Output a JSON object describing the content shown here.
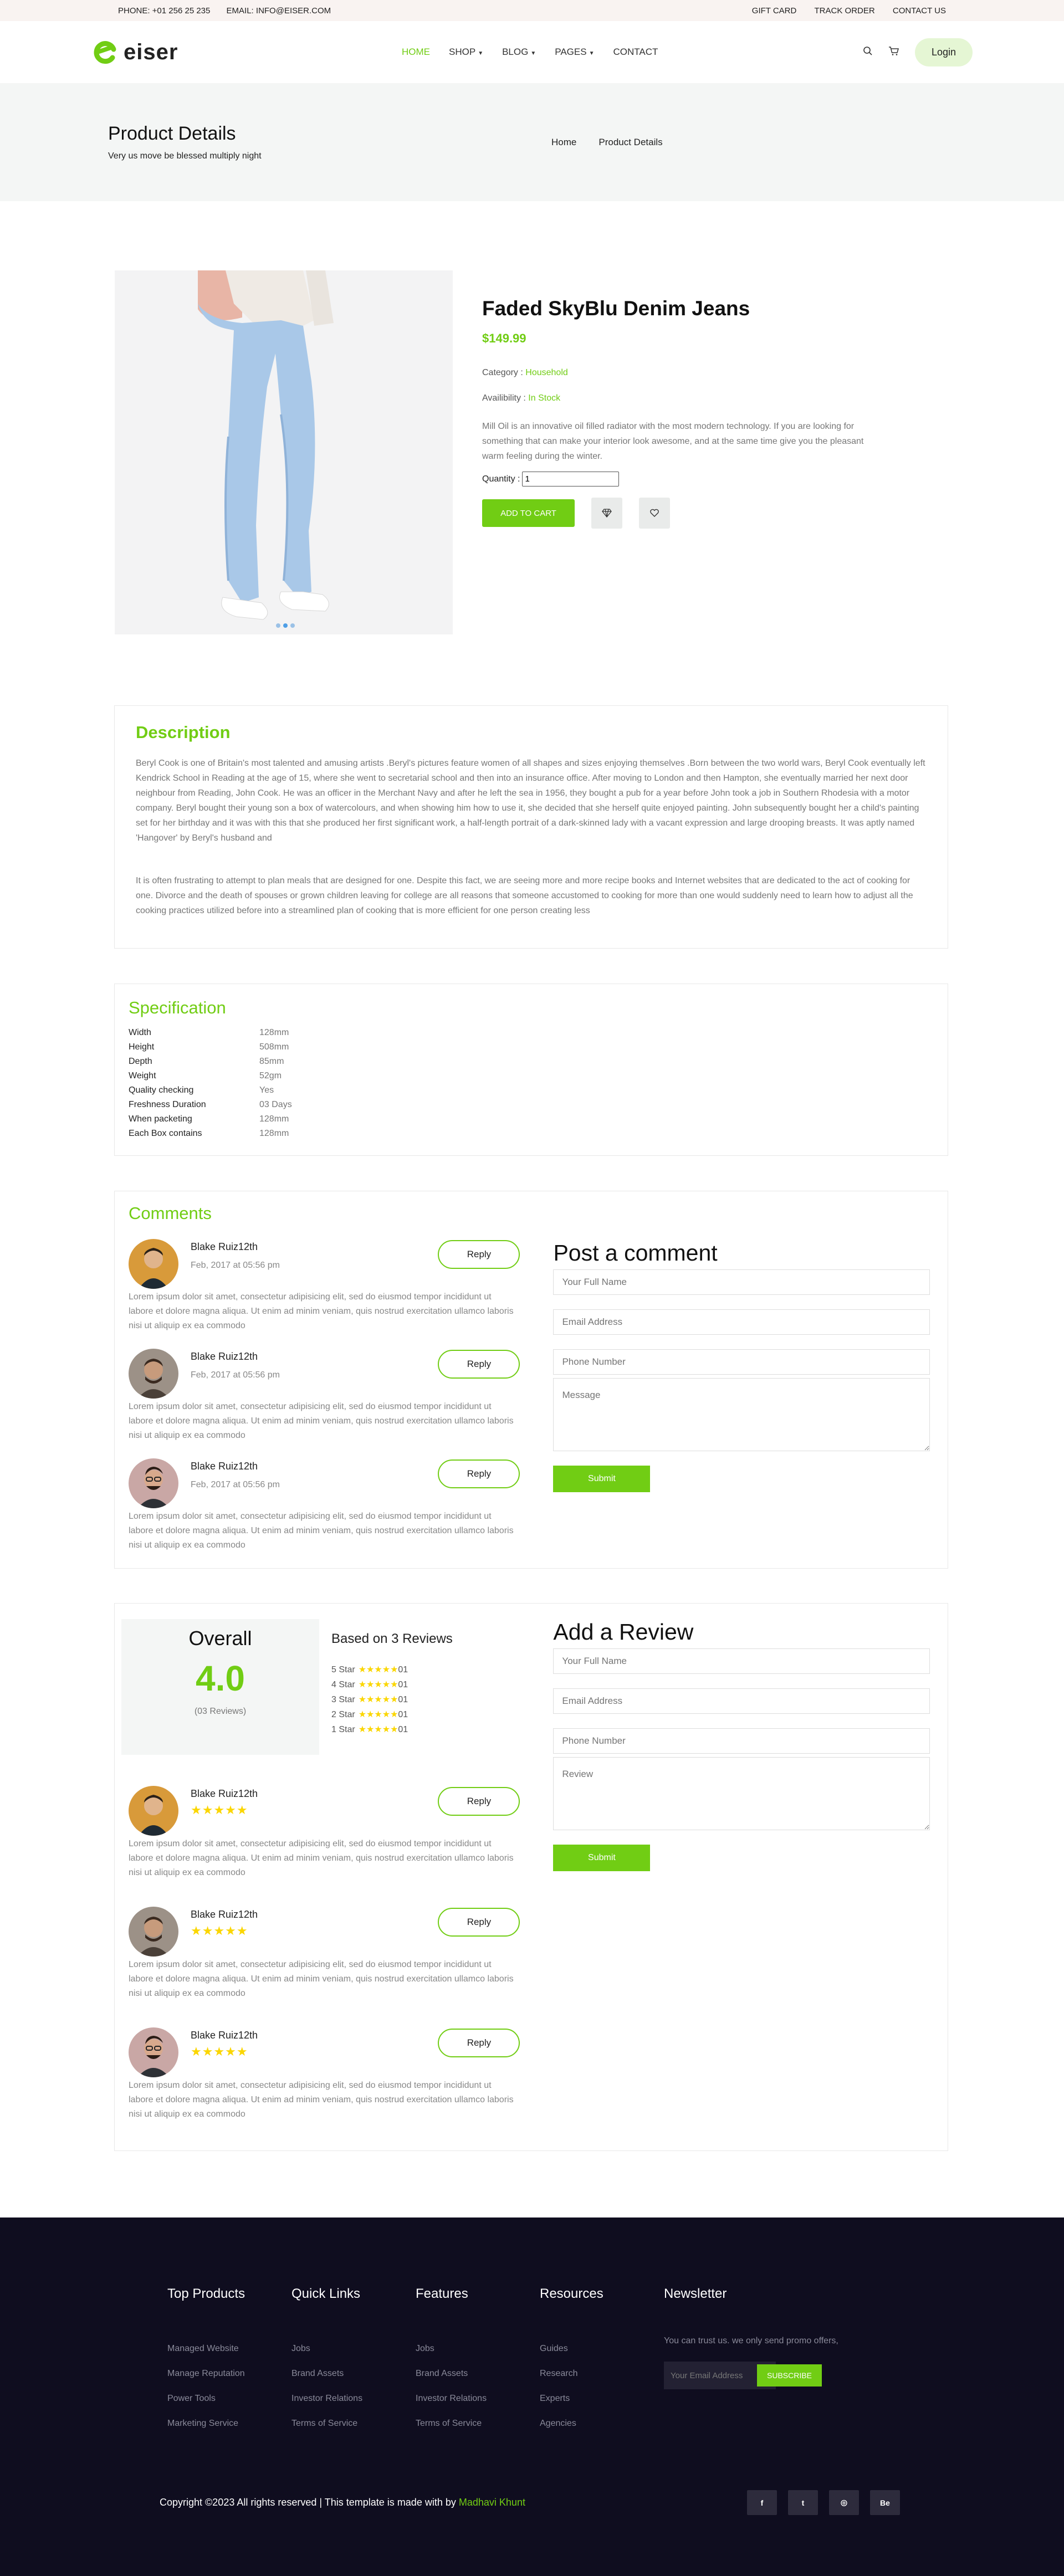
{
  "topbar": {
    "phone": "PHONE: +01 256 25 235",
    "email": "EMAIL: INFO@EISER.COM",
    "links": [
      "GIFT CARD",
      "TRACK ORDER",
      "CONTACT US"
    ]
  },
  "header": {
    "brand": "eiser",
    "nav": [
      "HOME",
      "SHOP",
      "BLOG",
      "PAGES",
      "CONTACT"
    ],
    "login": "Login",
    "accent": "#71cd14"
  },
  "banner": {
    "title": "Product Details",
    "subtitle": "Very us move be blessed multiply night",
    "crumbs": [
      "Home",
      "Product Details"
    ]
  },
  "product": {
    "name": "Faded SkyBlu Denim Jeans",
    "price": "$149.99",
    "category_label": "Category :",
    "category": "Household",
    "availability_label": "Availibility :",
    "availability": "In Stock",
    "description": "Mill Oil is an innovative oil filled radiator with the most modern technology. If you are looking for something that can make your interior look awesome, and at the same time give you the pleasant warm feeling during the winter.",
    "quantity_label": "Quantity :",
    "quantity": "1",
    "add_to_cart": "ADD TO CART"
  },
  "description": {
    "title": "Description",
    "p1": "Beryl Cook is one of Britain's most talented and amusing artists .Beryl's pictures feature women of all shapes and sizes enjoying themselves .Born between the two world wars, Beryl Cook eventually left Kendrick School in Reading at the age of 15, where she went to secretarial school and then into an insurance office. After moving to London and then Hampton, she eventually married her next door neighbour from Reading, John Cook. He was an officer in the Merchant Navy and after he left the sea in 1956, they bought a pub for a year before John took a job in Southern Rhodesia with a motor company. Beryl bought their young son a box of watercolours, and when showing him how to use it, she decided that she herself quite enjoyed painting. John subsequently bought her a child's painting set for her birthday and it was with this that she produced her first significant work, a half-length portrait of a dark-skinned lady with a vacant expression and large drooping breasts. It was aptly named 'Hangover' by Beryl's husband and",
    "p2": "It is often frustrating to attempt to plan meals that are designed for one. Despite this fact, we are seeing more and more recipe books and Internet websites that are dedicated to the act of cooking for one. Divorce and the death of spouses or grown children leaving for college are all reasons that someone accustomed to cooking for more than one would suddenly need to learn how to adjust all the cooking practices utilized before into a streamlined plan of cooking that is more efficient for one person creating less"
  },
  "specification": {
    "title": "Specification",
    "rows": [
      {
        "k": "Width",
        "v": "128mm"
      },
      {
        "k": "Height",
        "v": "508mm"
      },
      {
        "k": "Depth",
        "v": "85mm"
      },
      {
        "k": "Weight",
        "v": "52gm"
      },
      {
        "k": "Quality checking",
        "v": "Yes"
      },
      {
        "k": "Freshness Duration",
        "v": "03 Days"
      },
      {
        "k": "When packeting",
        "v": "128mm"
      },
      {
        "k": "Each Box contains",
        "v": "128mm"
      }
    ]
  },
  "comments": {
    "title": "Comments",
    "items": [
      {
        "name": "Blake Ruiz12th",
        "date": "Feb, 2017 at 05:56 pm",
        "text": "Lorem ipsum dolor sit amet, consectetur adipisicing elit, sed do eiusmod tempor incididunt ut labore et dolore magna aliqua. Ut enim ad minim veniam, quis nostrud exercitation ullamco laboris nisi ut aliquip ex ea commodo",
        "reply": "Reply"
      },
      {
        "name": "Blake Ruiz12th",
        "date": "Feb, 2017 at 05:56 pm",
        "text": "Lorem ipsum dolor sit amet, consectetur adipisicing elit, sed do eiusmod tempor incididunt ut labore et dolore magna aliqua. Ut enim ad minim veniam, quis nostrud exercitation ullamco laboris nisi ut aliquip ex ea commodo",
        "reply": "Reply"
      },
      {
        "name": "Blake Ruiz12th",
        "date": "Feb, 2017 at 05:56 pm",
        "text": "Lorem ipsum dolor sit amet, consectetur adipisicing elit, sed do eiusmod tempor incididunt ut labore et dolore magna aliqua. Ut enim ad minim veniam, quis nostrud exercitation ullamco laboris nisi ut aliquip ex ea commodo",
        "reply": "Reply"
      }
    ],
    "form": {
      "title": "Post a comment",
      "name": "Your Full Name",
      "email": "Email Address",
      "phone": "Phone Number",
      "message": "Message",
      "submit": "Submit"
    }
  },
  "reviews": {
    "overall_label": "Overall",
    "score": "4.0",
    "count": "(03 Reviews)",
    "based_on": "Based on 3 Reviews",
    "breakdown": [
      {
        "label": "5 Star",
        "stars": "★★★★★",
        "count": "01"
      },
      {
        "label": "4 Star",
        "stars": "★★★★★",
        "count": "01"
      },
      {
        "label": "3 Star",
        "stars": "★★★★★",
        "count": "01"
      },
      {
        "label": "2 Star",
        "stars": "★★★★★",
        "count": "01"
      },
      {
        "label": "1 Star",
        "stars": "★★★★★",
        "count": "01"
      }
    ],
    "items": [
      {
        "name": "Blake Ruiz12th",
        "stars": "★★★★★",
        "text": "Lorem ipsum dolor sit amet, consectetur adipisicing elit, sed do eiusmod tempor incididunt ut labore et dolore magna aliqua. Ut enim ad minim veniam, quis nostrud exercitation ullamco laboris nisi ut aliquip ex ea commodo",
        "reply": "Reply"
      },
      {
        "name": "Blake Ruiz12th",
        "stars": "★★★★★",
        "text": "Lorem ipsum dolor sit amet, consectetur adipisicing elit, sed do eiusmod tempor incididunt ut labore et dolore magna aliqua. Ut enim ad minim veniam, quis nostrud exercitation ullamco laboris nisi ut aliquip ex ea commodo",
        "reply": "Reply"
      },
      {
        "name": "Blake Ruiz12th",
        "stars": "★★★★★",
        "text": "Lorem ipsum dolor sit amet, consectetur adipisicing elit, sed do eiusmod tempor incididunt ut labore et dolore magna aliqua. Ut enim ad minim veniam, quis nostrud exercitation ullamco laboris nisi ut aliquip ex ea commodo",
        "reply": "Reply"
      }
    ],
    "form": {
      "title": "Add a Review",
      "name": "Your Full Name",
      "email": "Email Address",
      "phone": "Phone Number",
      "review": "Review",
      "submit": "Submit"
    }
  },
  "footer": {
    "columns": [
      {
        "title": "Top Products",
        "links": [
          "Managed Website",
          "Manage Reputation",
          "Power Tools",
          "Marketing Service"
        ]
      },
      {
        "title": "Quick Links",
        "links": [
          "Jobs",
          "Brand Assets",
          "Investor Relations",
          "Terms of Service"
        ]
      },
      {
        "title": "Features",
        "links": [
          "Jobs",
          "Brand Assets",
          "Investor Relations",
          "Terms of Service"
        ]
      },
      {
        "title": "Resources",
        "links": [
          "Guides",
          "Research",
          "Experts",
          "Agencies"
        ]
      }
    ],
    "newsletter": {
      "title": "Newsletter",
      "text": "You can trust us. we only send promo offers,",
      "placeholder": "Your Email Address",
      "button": "SUBSCRIBE"
    },
    "copyright": "Copyright ©2023 All rights reserved | This template is made with by",
    "author": "Madhavi Khunt",
    "socials": [
      "facebook-icon",
      "twitter-icon",
      "dribbble-icon",
      "behance-icon"
    ],
    "social_glyphs": [
      "f",
      "t",
      "◎",
      "Be"
    ]
  }
}
